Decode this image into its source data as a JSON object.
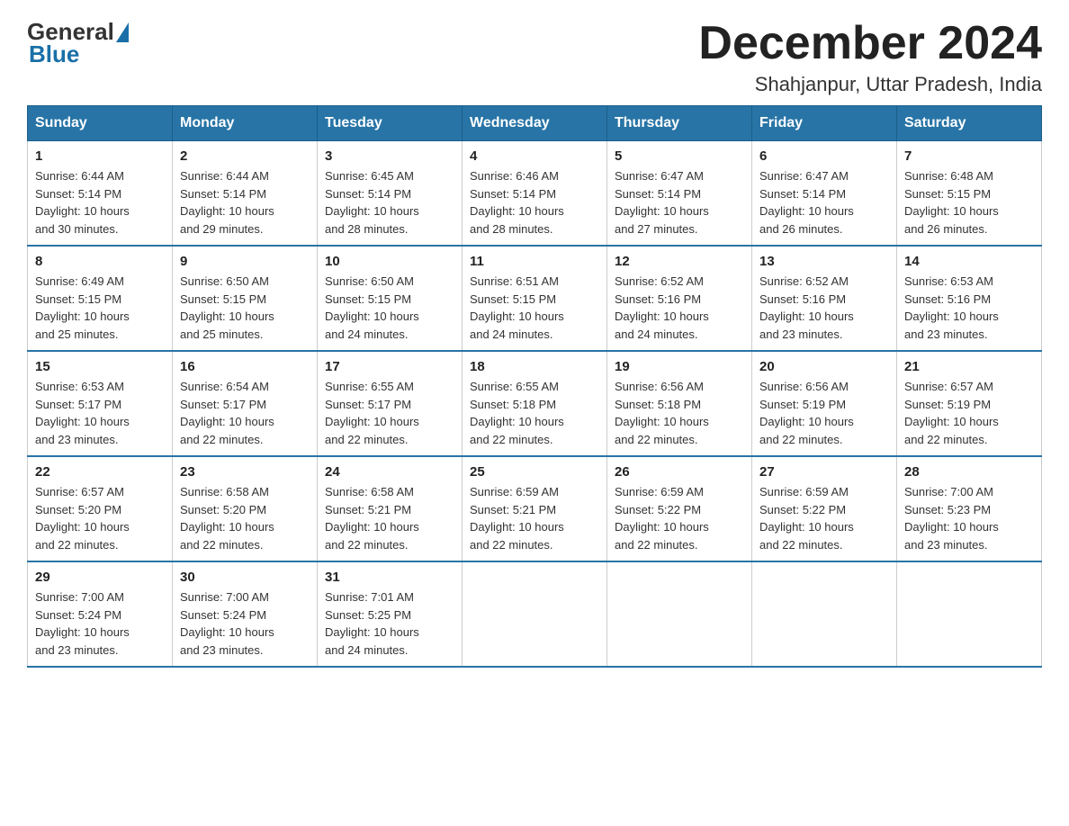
{
  "header": {
    "logo": {
      "general": "General",
      "triangle_color": "#1a6fa8",
      "blue": "Blue"
    },
    "month_title": "December 2024",
    "subtitle": "Shahjanpur, Uttar Pradesh, India"
  },
  "days_of_week": [
    "Sunday",
    "Monday",
    "Tuesday",
    "Wednesday",
    "Thursday",
    "Friday",
    "Saturday"
  ],
  "weeks": [
    [
      {
        "day": "1",
        "sunrise": "6:44 AM",
        "sunset": "5:14 PM",
        "daylight": "10 hours and 30 minutes."
      },
      {
        "day": "2",
        "sunrise": "6:44 AM",
        "sunset": "5:14 PM",
        "daylight": "10 hours and 29 minutes."
      },
      {
        "day": "3",
        "sunrise": "6:45 AM",
        "sunset": "5:14 PM",
        "daylight": "10 hours and 28 minutes."
      },
      {
        "day": "4",
        "sunrise": "6:46 AM",
        "sunset": "5:14 PM",
        "daylight": "10 hours and 28 minutes."
      },
      {
        "day": "5",
        "sunrise": "6:47 AM",
        "sunset": "5:14 PM",
        "daylight": "10 hours and 27 minutes."
      },
      {
        "day": "6",
        "sunrise": "6:47 AM",
        "sunset": "5:14 PM",
        "daylight": "10 hours and 26 minutes."
      },
      {
        "day": "7",
        "sunrise": "6:48 AM",
        "sunset": "5:15 PM",
        "daylight": "10 hours and 26 minutes."
      }
    ],
    [
      {
        "day": "8",
        "sunrise": "6:49 AM",
        "sunset": "5:15 PM",
        "daylight": "10 hours and 25 minutes."
      },
      {
        "day": "9",
        "sunrise": "6:50 AM",
        "sunset": "5:15 PM",
        "daylight": "10 hours and 25 minutes."
      },
      {
        "day": "10",
        "sunrise": "6:50 AM",
        "sunset": "5:15 PM",
        "daylight": "10 hours and 24 minutes."
      },
      {
        "day": "11",
        "sunrise": "6:51 AM",
        "sunset": "5:15 PM",
        "daylight": "10 hours and 24 minutes."
      },
      {
        "day": "12",
        "sunrise": "6:52 AM",
        "sunset": "5:16 PM",
        "daylight": "10 hours and 24 minutes."
      },
      {
        "day": "13",
        "sunrise": "6:52 AM",
        "sunset": "5:16 PM",
        "daylight": "10 hours and 23 minutes."
      },
      {
        "day": "14",
        "sunrise": "6:53 AM",
        "sunset": "5:16 PM",
        "daylight": "10 hours and 23 minutes."
      }
    ],
    [
      {
        "day": "15",
        "sunrise": "6:53 AM",
        "sunset": "5:17 PM",
        "daylight": "10 hours and 23 minutes."
      },
      {
        "day": "16",
        "sunrise": "6:54 AM",
        "sunset": "5:17 PM",
        "daylight": "10 hours and 22 minutes."
      },
      {
        "day": "17",
        "sunrise": "6:55 AM",
        "sunset": "5:17 PM",
        "daylight": "10 hours and 22 minutes."
      },
      {
        "day": "18",
        "sunrise": "6:55 AM",
        "sunset": "5:18 PM",
        "daylight": "10 hours and 22 minutes."
      },
      {
        "day": "19",
        "sunrise": "6:56 AM",
        "sunset": "5:18 PM",
        "daylight": "10 hours and 22 minutes."
      },
      {
        "day": "20",
        "sunrise": "6:56 AM",
        "sunset": "5:19 PM",
        "daylight": "10 hours and 22 minutes."
      },
      {
        "day": "21",
        "sunrise": "6:57 AM",
        "sunset": "5:19 PM",
        "daylight": "10 hours and 22 minutes."
      }
    ],
    [
      {
        "day": "22",
        "sunrise": "6:57 AM",
        "sunset": "5:20 PM",
        "daylight": "10 hours and 22 minutes."
      },
      {
        "day": "23",
        "sunrise": "6:58 AM",
        "sunset": "5:20 PM",
        "daylight": "10 hours and 22 minutes."
      },
      {
        "day": "24",
        "sunrise": "6:58 AM",
        "sunset": "5:21 PM",
        "daylight": "10 hours and 22 minutes."
      },
      {
        "day": "25",
        "sunrise": "6:59 AM",
        "sunset": "5:21 PM",
        "daylight": "10 hours and 22 minutes."
      },
      {
        "day": "26",
        "sunrise": "6:59 AM",
        "sunset": "5:22 PM",
        "daylight": "10 hours and 22 minutes."
      },
      {
        "day": "27",
        "sunrise": "6:59 AM",
        "sunset": "5:22 PM",
        "daylight": "10 hours and 22 minutes."
      },
      {
        "day": "28",
        "sunrise": "7:00 AM",
        "sunset": "5:23 PM",
        "daylight": "10 hours and 23 minutes."
      }
    ],
    [
      {
        "day": "29",
        "sunrise": "7:00 AM",
        "sunset": "5:24 PM",
        "daylight": "10 hours and 23 minutes."
      },
      {
        "day": "30",
        "sunrise": "7:00 AM",
        "sunset": "5:24 PM",
        "daylight": "10 hours and 23 minutes."
      },
      {
        "day": "31",
        "sunrise": "7:01 AM",
        "sunset": "5:25 PM",
        "daylight": "10 hours and 24 minutes."
      },
      null,
      null,
      null,
      null
    ]
  ],
  "labels": {
    "sunrise": "Sunrise:",
    "sunset": "Sunset:",
    "daylight": "Daylight:"
  }
}
